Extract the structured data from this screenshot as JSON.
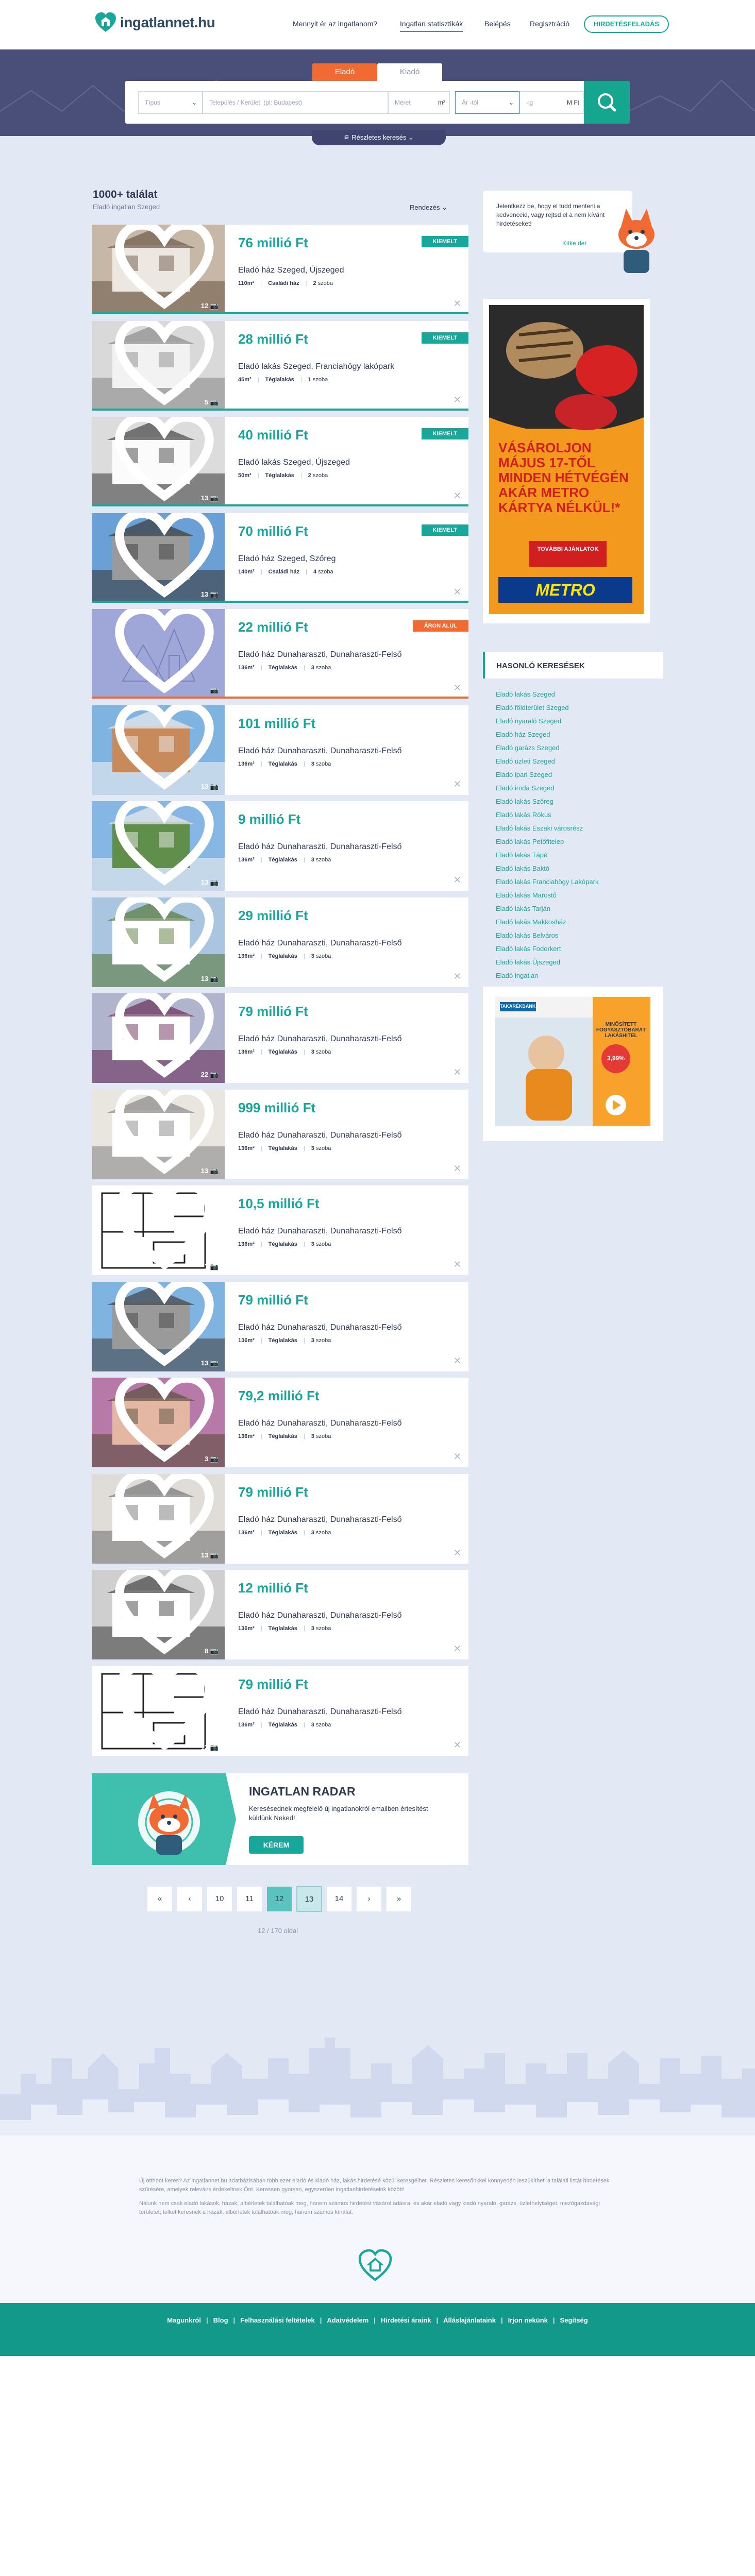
{
  "header": {
    "brand": "ingatlannet.hu",
    "nav": [
      "Mennyit ér az ingatlanom?",
      "Ingatlan statisztikák",
      "Belépés",
      "Regisztráció"
    ],
    "ad_button": "HIRDETÉSFELADÁS",
    "colors": {
      "teal": "#17a89b",
      "orange": "#f06a32",
      "navy": "#4a4f7a",
      "bg": "#e3e8f5"
    }
  },
  "search": {
    "tab_sale": "Eladó",
    "tab_rent": "Kiadó",
    "type_placeholder": "Típus",
    "location_placeholder": "Település / Kerület, (pl: Budapest)",
    "area_placeholder": "Méret",
    "area_unit": "m²",
    "price_from": "Ár -tól",
    "price_to": "-ig",
    "price_unit": "M Ft",
    "advanced": "Részletes keresés"
  },
  "results": {
    "count": "1000+ találat",
    "subtitle": "Eladó ingatlan Szeged",
    "sort": "Rendezés"
  },
  "listings": [
    {
      "price": "76 millió Ft",
      "title": "Eladó ház Szeged, Újszeged",
      "size": "110m²",
      "kind": "Családi ház",
      "rooms": "2",
      "rooms_label": "szoba",
      "badge": "KIEMELT",
      "photos": "12"
    },
    {
      "price": "28 millió Ft",
      "title": "Eladó lakás Szeged, Franciahögy lakópark",
      "size": "45m²",
      "kind": "Téglalakás",
      "rooms": "1",
      "rooms_label": "szoba",
      "badge": "KIEMELT",
      "photos": "5"
    },
    {
      "price": "40 millió Ft",
      "title": "Eladó lakás Szeged, Újszeged",
      "size": "50m²",
      "kind": "Téglalakás",
      "rooms": "2",
      "rooms_label": "szoba",
      "badge": "KIEMELT",
      "photos": "13"
    },
    {
      "price": "70 millió Ft",
      "title": "Eladó ház Szeged, Szőreg",
      "size": "140m²",
      "kind": "Családi ház",
      "rooms": "4",
      "rooms_label": "szoba",
      "badge": "KIEMELT",
      "photos": "13"
    },
    {
      "price": "22 millió Ft",
      "title": "Eladó ház Dunaharaszti, Dunaharaszti-Felső",
      "size": "136m²",
      "kind": "Téglalakás",
      "rooms": "3",
      "rooms_label": "szoba",
      "badge": "ÁRON ALUL",
      "photos": ""
    },
    {
      "price": "101 millió Ft",
      "title": "Eladó ház Dunaharaszti, Dunaharaszti-Felső",
      "size": "136m²",
      "kind": "Téglalakás",
      "rooms": "3",
      "rooms_label": "szoba",
      "badge": "",
      "photos": "13"
    },
    {
      "price": "9 millió Ft",
      "title": "Eladó ház Dunaharaszti, Dunaharaszti-Felső",
      "size": "136m²",
      "kind": "Téglalakás",
      "rooms": "3",
      "rooms_label": "szoba",
      "badge": "",
      "photos": "13"
    },
    {
      "price": "29 millió Ft",
      "title": "Eladó ház Dunaharaszti, Dunaharaszti-Felső",
      "size": "136m²",
      "kind": "Téglalakás",
      "rooms": "3",
      "rooms_label": "szoba",
      "badge": "",
      "photos": "13"
    },
    {
      "price": "79 millió Ft",
      "title": "Eladó ház Dunaharaszti, Dunaharaszti-Felső",
      "size": "136m²",
      "kind": "Téglalakás",
      "rooms": "3",
      "rooms_label": "szoba",
      "badge": "",
      "photos": "22"
    },
    {
      "price": "999 millió Ft",
      "title": "Eladó ház Dunaharaszti, Dunaharaszti-Felső",
      "size": "136m²",
      "kind": "Téglalakás",
      "rooms": "3",
      "rooms_label": "szoba",
      "badge": "",
      "photos": "13"
    },
    {
      "price": "10,5 millió Ft",
      "title": "Eladó ház Dunaharaszti, Dunaharaszti-Felső",
      "size": "136m²",
      "kind": "Téglalakás",
      "rooms": "3",
      "rooms_label": "szoba",
      "badge": "",
      "photos": "7"
    },
    {
      "price": "79 millió Ft",
      "title": "Eladó ház Dunaharaszti, Dunaharaszti-Felső",
      "size": "136m²",
      "kind": "Téglalakás",
      "rooms": "3",
      "rooms_label": "szoba",
      "badge": "",
      "photos": "13"
    },
    {
      "price": "79,2 millió Ft",
      "title": "Eladó ház Dunaharaszti, Dunaharaszti-Felső",
      "size": "136m²",
      "kind": "Téglalakás",
      "rooms": "3",
      "rooms_label": "szoba",
      "badge": "",
      "photos": "3"
    },
    {
      "price": "79 millió Ft",
      "title": "Eladó ház Dunaharaszti, Dunaharaszti-Felső",
      "size": "136m²",
      "kind": "Téglalakás",
      "rooms": "3",
      "rooms_label": "szoba",
      "badge": "",
      "photos": "13"
    },
    {
      "price": "12 millió Ft",
      "title": "Eladó ház Dunaharaszti, Dunaharaszti-Felső",
      "size": "136m²",
      "kind": "Téglalakás",
      "rooms": "3",
      "rooms_label": "szoba",
      "badge": "",
      "photos": "8"
    },
    {
      "price": "79 millió Ft",
      "title": "Eladó ház Dunaharaszti, Dunaharaszti-Felső",
      "size": "136m²",
      "kind": "Téglalakás",
      "rooms": "3",
      "rooms_label": "szoba",
      "badge": "",
      "photos": "13"
    }
  ],
  "radar": {
    "title": "INGATLAN RADAR",
    "text": "Keresésednek megfelelő új ingatlanokról emailben értesítést küldünk Neked!",
    "button": "KÉREM"
  },
  "pagination": {
    "pages": [
      "10",
      "11",
      "12",
      "13",
      "14"
    ],
    "current": "12",
    "info": "12 / 170 oldal"
  },
  "sidebar": {
    "welcome": "Jelentkezz be, hogy el tudd menteni a kedvenceid, vagy rejtsd el a nem kívánt hirdetéseket!",
    "welcome_bold": "Jelentkezz be",
    "welcome_link": "Kitke der",
    "ad1": {
      "headline": "VÁSÁROLJON MÁJUS 17-TŐL MINDEN HÉTVÉGÉN AKÁR METRO KÁRTYA NÉLKÜL!*",
      "cta": "TOVÁBBI AJÁNLATOK",
      "brand": "METRO"
    },
    "similar_title": "HASONLÓ KERESÉSEK",
    "similar": [
      "Eladó lakás Szeged",
      "Eladó földterület Szeged",
      "Eladó nyaraló Szeged",
      "Eladó ház Szeged",
      "Eladó garázs Szeged",
      "Eladó üzleti Szeged",
      "Eladó ipari Szeged",
      "Eladó iroda Szeged",
      "Eladó lakás Szőreg",
      "Eladó lakás Rókus",
      "Eladó lakás Északi városrész",
      "Eladó lakás Petőfitelep",
      "Eladó lakás Tápé",
      "Eladó lakás Baktó",
      "Eladó lakás Franciahögy Lakópark",
      "Eladó lakás Marostő",
      "Eladó lakás Tarján",
      "Eladó lakás Makkosház",
      "Eladó lakás Belváros",
      "Eladó lakás Fodorkert",
      "Eladó lakás Újszeged",
      "Eladó ingatlan"
    ],
    "ad2": {
      "brand": "TAKARÉKBANK",
      "headline": "MINŐSÍTETT FOGYASZTÓBARÁT LAKÁSHITEL",
      "rate": "3,99%"
    }
  },
  "footer": {
    "para1": "Új otthont keres? Az ingatlannet.hu adatbázisában több ezer eladó és kiadó ház, lakás hirdetésé közül keresgélhet. Részletes keresőnkkel könnyedén leszűkítheti a találati listát hirdetések szűrésére, amelyek releváns érdekeltnek Önt. Keressen gyorsan, egyszerűen ingatlanhirdetéseink között!",
    "para2": "Nálunk nem csak eladó lakások, házak, albérletek találhatóak meg, hanem számos hirdetést vásárol adásra, és akár eladó vagy kiadó nyaraló, garázs, üzlethelyiséget, mezőgazdasági területet, telket keresnek a házak, albérletek találhatóak meg, hanem számos kínálat.",
    "links": [
      "Magunkról",
      "Blog",
      "Felhasználási feltételek",
      "Adatvédelem",
      "Hirdetési áraink",
      "Álláslajánlataink",
      "Irjon nekünk",
      "Segítség"
    ]
  }
}
